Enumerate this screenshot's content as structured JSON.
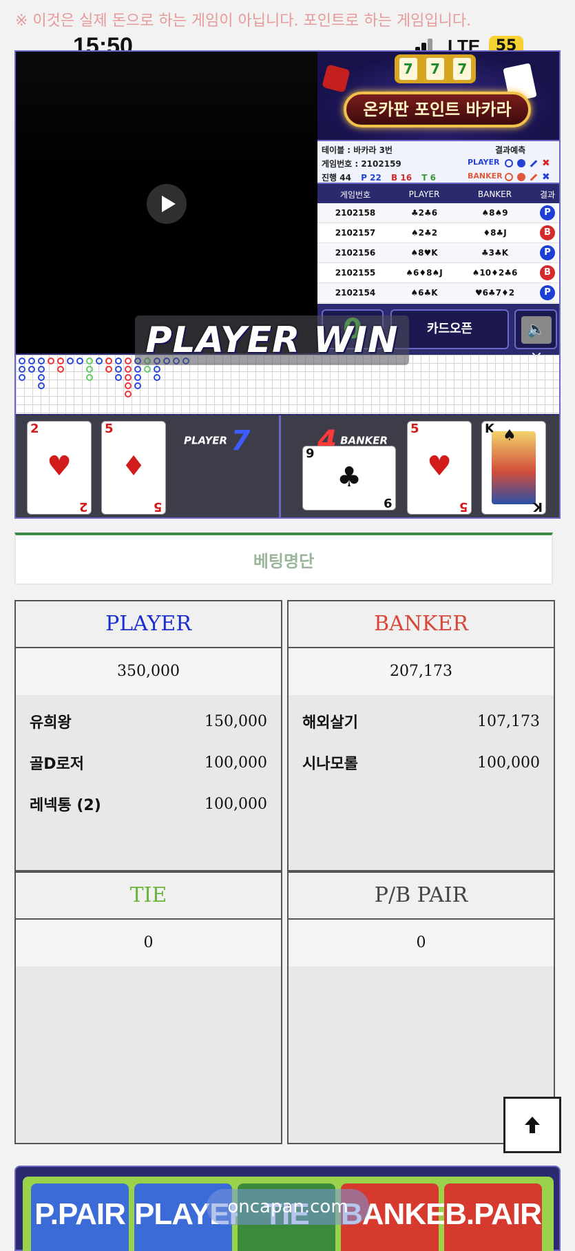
{
  "notice": "※ 이것은 실제 돈으로 하는 게임이 아닙니다. 포인트로 하는 게임입니다.",
  "status_bar": {
    "time": "15:50",
    "network": "LTE",
    "battery": "55"
  },
  "banner": {
    "title": "온카판 포인트 바카라",
    "slot": [
      "7",
      "7",
      "7"
    ]
  },
  "game_info": {
    "table": "테이블 : 바카라 3번",
    "game_number": "게임번호 : 2102159",
    "progress_label": "진행 44",
    "player_count": "P 22",
    "banker_count": "B 16",
    "tie_count": "T 6",
    "prediction_title": "결과예측",
    "prediction_player": "PLAYER",
    "prediction_banker": "BANKER"
  },
  "history": {
    "headers": [
      "게임번호",
      "PLAYER",
      "BANKER",
      "결과"
    ],
    "rows": [
      {
        "id": "2102158",
        "player": "♣2♣6",
        "banker": "♠8♠9",
        "result": "P"
      },
      {
        "id": "2102157",
        "player": "♠2♣2",
        "banker": "♦8♣J",
        "result": "B"
      },
      {
        "id": "2102156",
        "player": "♠8♥K",
        "banker": "♣3♣K",
        "result": "P"
      },
      {
        "id": "2102155",
        "player": "♠6♦8♠J",
        "banker": "♠10♦2♣6",
        "result": "B"
      },
      {
        "id": "2102154",
        "player": "♠6♣K",
        "banker": "♥6♣7♦2",
        "result": "P"
      }
    ]
  },
  "controls": {
    "count": "0",
    "open_label": "카드오픈",
    "mute_symbol": "×"
  },
  "win_banner": "PLAYER WIN",
  "scores": {
    "player_label": "PLAYER",
    "player_score": "7",
    "banker_label": "BANKER",
    "banker_score": "4"
  },
  "player_cards": [
    {
      "rank": "2",
      "suit": "♥",
      "color": "#d21c1c"
    },
    {
      "rank": "5",
      "suit": "♦",
      "color": "#d21c1c"
    }
  ],
  "banker_cards": [
    {
      "rank": "9",
      "suit": "♣",
      "color": "#111111"
    },
    {
      "rank": "5",
      "suit": "♥",
      "color": "#d21c1c"
    },
    {
      "rank": "K",
      "suit": "♠",
      "color": "#111111"
    }
  ],
  "betting": {
    "title": "베팅명단",
    "player": {
      "label": "PLAYER",
      "color": "#1b2fd0",
      "total": "350,000",
      "bets": [
        {
          "name": "유희왕",
          "amount": "150,000"
        },
        {
          "name": "골D로저",
          "amount": "100,000"
        },
        {
          "name": "레넥통 (2)",
          "amount": "100,000"
        }
      ]
    },
    "banker": {
      "label": "BANKER",
      "color": "#d9473a",
      "total": "207,173",
      "bets": [
        {
          "name": "해외살기",
          "amount": "107,173"
        },
        {
          "name": "시나모롤",
          "amount": "100,000"
        }
      ]
    },
    "tie": {
      "label": "TIE",
      "color": "#6bb43a",
      "total": "0"
    },
    "pair": {
      "label": "P/B PAIR",
      "color": "#444444",
      "total": "0"
    }
  },
  "bet_buttons": [
    {
      "label": "P.PAIR",
      "color": "#3b6bd6"
    },
    {
      "label": "PLAYER",
      "color": "#3b6bd6"
    },
    {
      "label": "TIE",
      "color": "#3a8a3a"
    },
    {
      "label": "BANKER",
      "color": "#d63a2e"
    },
    {
      "label": "B.PAIR",
      "color": "#d63a2e"
    }
  ],
  "watermark": "oncapan.com",
  "colors": {
    "accent_purple": "#6b68c9",
    "dark_navy": "#2c2a6e",
    "green_line": "#3e8b45"
  }
}
